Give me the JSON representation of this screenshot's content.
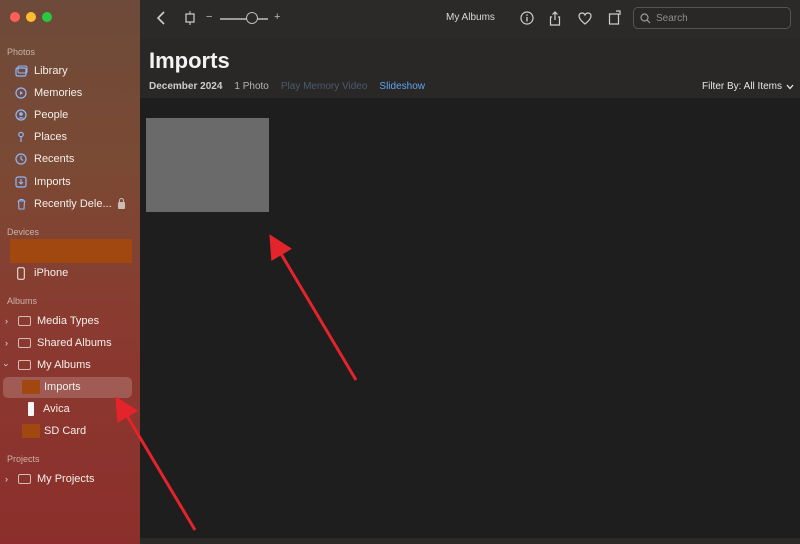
{
  "sidebar": {
    "sections": {
      "photos": "Photos",
      "devices": "Devices",
      "albums": "Albums",
      "projects": "Projects"
    },
    "photos_items": [
      {
        "label": "Library",
        "icon": "library-icon"
      },
      {
        "label": "Memories",
        "icon": "memories-icon"
      },
      {
        "label": "People",
        "icon": "people-icon"
      },
      {
        "label": "Places",
        "icon": "places-icon"
      },
      {
        "label": "Recents",
        "icon": "recents-icon"
      },
      {
        "label": "Imports",
        "icon": "imports-icon"
      },
      {
        "label": "Recently Dele...",
        "icon": "trash-icon"
      }
    ],
    "device_item": {
      "label": "iPhone",
      "icon": "iphone-icon"
    },
    "albums_items": [
      {
        "label": "Media Types"
      },
      {
        "label": "Shared Albums"
      },
      {
        "label": "My Albums"
      }
    ],
    "my_albums_children": [
      {
        "label": "Imports",
        "selected": true
      },
      {
        "label": "Avica"
      },
      {
        "label": "SD Card"
      }
    ],
    "projects_items": [
      {
        "label": "My Projects"
      }
    ]
  },
  "toolbar": {
    "zoom_minus": "−",
    "zoom_plus": "+",
    "my_albums_label": "My Albums",
    "search_placeholder": "Search"
  },
  "main": {
    "title": "Imports",
    "date": "December 2024",
    "count": "1 Photo",
    "play_memory": "Play Memory Video",
    "slideshow": "Slideshow",
    "filter": "Filter By: All Items"
  },
  "colors": {
    "accent_link": "#5ea3f0",
    "arrow_red": "#e3242b",
    "redacted_orange": "#a0480f"
  }
}
